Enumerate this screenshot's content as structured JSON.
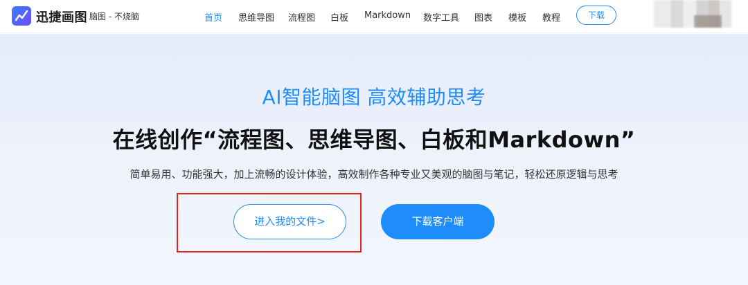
{
  "header": {
    "brand": "迅捷画图",
    "tagline": "脑图 - 不烧脑",
    "nav": [
      {
        "label": "首页",
        "active": true
      },
      {
        "label": "思维导图",
        "active": false
      },
      {
        "label": "流程图",
        "active": false
      },
      {
        "label": "白板",
        "active": false
      },
      {
        "label": "Markdown",
        "active": false
      },
      {
        "label": "数字工具",
        "active": false
      },
      {
        "label": "图表",
        "active": false
      },
      {
        "label": "模板",
        "active": false
      },
      {
        "label": "教程",
        "active": false
      }
    ],
    "download_label": "下载",
    "logo_icon": "chart-line-icon",
    "accent_color": "#1e8cfa"
  },
  "hero": {
    "subtitle": "AI智能脑图  高效辅助思考",
    "title": "在线创作“流程图、思维导图、白板和Markdown”",
    "description": "简单易用、功能强大，加上流畅的设计体验，高效制作各种专业又美观的脑图与笔记，轻松还原逻辑与思考",
    "enter_files_label": "进入我的文件>",
    "download_client_label": "下载客户端",
    "highlight_color": "#e8231b"
  }
}
